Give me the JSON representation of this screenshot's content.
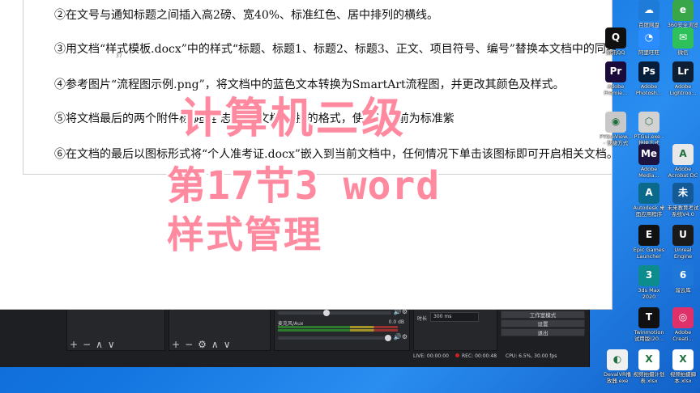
{
  "document": {
    "lines": [
      "②在文号与通知标题之间插入高2磅、宽40%、标准红色、居中排列的横线。",
      "③用文档“样式模板.docx”中的样式“标题、标题1、标题2、标题3、正文、项目符号、编号”替换本文档中的同名",
      "④参考图片“流程图示例.png”，将文档中的蓝色文本转换为SmartArt流程图，并更改其颜色及样式。",
      "⑤将文档最后的两个附件标       超链      志            同名文档。        接的格式，使其访问前为标准紫",
      "⑥在文档的最后以图标形式将“个人准考证.docx”嵌入到当前文档中，任何情况下单击该图标即可开启相关文档。"
    ],
    "page_marker": "37"
  },
  "overlay": {
    "title": "计算机二级",
    "subtitle": "第17节3 word",
    "topic": "样式管理"
  },
  "obs": {
    "toolbar_left": [
      "+",
      "−",
      "∧",
      "∨"
    ],
    "toolbar_middle": [
      "+",
      "−",
      "⚙",
      "∧",
      "∨"
    ],
    "mixer_source": "麦克风/Aux",
    "mixer_db": "0.0 dB",
    "transition_label": "时长",
    "transition_value": "300 ms",
    "controls": [
      "工作室模式",
      "设置",
      "退出"
    ],
    "status": {
      "live": "LIVE: 00:00:00",
      "rec": "REC: 00:00:48",
      "cpu": "CPU: 6.5%, 30.00 fps"
    }
  },
  "desktop_icons": [
    {
      "label": "百度网盘",
      "icon": "baidu-netdisk-icon",
      "color": "#1f7bd8",
      "glyph": "☁"
    },
    {
      "label": "360安全浏览器",
      "icon": "360-browser-icon",
      "color": "#3aa64a",
      "glyph": "e"
    },
    {
      "label": "腾讯QQ",
      "icon": "qq-icon",
      "color": "#101010",
      "glyph": "Q"
    },
    {
      "label": "阿里旺旺",
      "icon": "aliwangwang-icon",
      "color": "#2b8cff",
      "glyph": "◔"
    },
    {
      "label": "微信",
      "icon": "wechat-icon",
      "color": "#2ec15b",
      "glyph": "✉"
    },
    {
      "label": "Adobe Premie...",
      "icon": "premiere-icon",
      "color": "#1a0b3a",
      "glyph": "Pr"
    },
    {
      "label": "Adobe Photosh...",
      "icon": "photoshop-icon",
      "color": "#061e3c",
      "glyph": "Ps"
    },
    {
      "label": "Adobe Lightroo...",
      "icon": "lightroom-icon",
      "color": "#0f1f33",
      "glyph": "Lr"
    },
    {
      "label": "PTGuiView... - 快捷方式",
      "icon": "ptgui-viewer-icon",
      "color": "#c8c8c8",
      "glyph": "◉"
    },
    {
      "label": "PTGui.exe - 快捷方式",
      "icon": "ptgui-icon",
      "color": "#d2d2d2",
      "glyph": "⬡"
    },
    {
      "label": "Adobe Media...",
      "icon": "media-encoder-icon",
      "color": "#1d1340",
      "glyph": "Me"
    },
    {
      "label": "Adobe Acrobat DC",
      "icon": "acrobat-icon",
      "color": "#e8e8e8",
      "glyph": "A"
    },
    {
      "label": "Autodesk 桌面应用程序",
      "icon": "autodesk-icon",
      "color": "#0b6a8c",
      "glyph": "A"
    },
    {
      "label": "未来教育考试系统V4.0",
      "icon": "exam-system-icon",
      "color": "#145a96",
      "glyph": "未"
    },
    {
      "label": "Epic Games Launcher",
      "icon": "epic-games-icon",
      "color": "#111111",
      "glyph": "E"
    },
    {
      "label": "Unreal Engine",
      "icon": "unreal-engine-icon",
      "color": "#1a1a1a",
      "glyph": "U"
    },
    {
      "label": "3ds Max 2020",
      "icon": "3ds-max-icon",
      "color": "#0c8c8c",
      "glyph": "3"
    },
    {
      "label": "溜云库",
      "icon": "liuyunku-icon",
      "color": "#1e78d8",
      "glyph": "6"
    },
    {
      "label": "Twinmotion 试用版(20...",
      "icon": "twinmotion-icon",
      "color": "#111111",
      "glyph": "T"
    },
    {
      "label": "Adobe Creati...",
      "icon": "creative-cloud-icon",
      "color": "#e0306a",
      "glyph": "◎"
    },
    {
      "label": "DevalVR播放器.exe",
      "icon": "devalvr-icon",
      "color": "#f0f0f0",
      "glyph": "◐"
    },
    {
      "label": "视频拍摄计划表.xlsx",
      "icon": "excel-file-icon",
      "color": "#ffffff",
      "glyph": "X"
    },
    {
      "label": "视频拍摄脚本.xlsx",
      "icon": "excel-file-icon",
      "color": "#ffffff",
      "glyph": "X"
    }
  ]
}
